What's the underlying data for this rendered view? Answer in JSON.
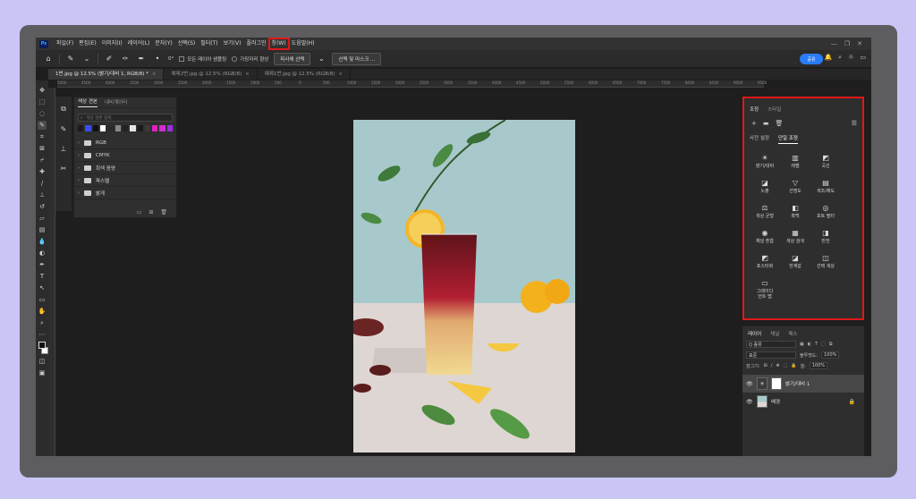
{
  "app": {
    "logo": "Ps"
  },
  "menu": [
    {
      "label": "파일(F)"
    },
    {
      "label": "편집(E)"
    },
    {
      "label": "이미지(I)"
    },
    {
      "label": "레이어(L)"
    },
    {
      "label": "문자(Y)"
    },
    {
      "label": "선택(S)"
    },
    {
      "label": "필터(T)"
    },
    {
      "label": "보기(V)"
    },
    {
      "label": "플러그인"
    },
    {
      "label": "창(W)"
    },
    {
      "label": "도움말(H)"
    }
  ],
  "window_controls": [
    "—",
    "❐",
    "✕"
  ],
  "options": {
    "angle": "0°",
    "sample_all_layers": "모든 레이어 샘플링",
    "enhance_edge": "가장자리 향상",
    "subject_button": "피사체 선택",
    "mask_button": "선택 및 마스크 ...",
    "share_label": "공유"
  },
  "tabs": [
    {
      "label": "1번.jpg @ 12.5% (밝기/대비 1, RGB/8) *",
      "active": true
    },
    {
      "label": "예제2번.jpg @ 12.5% (RGB/8)",
      "active": false
    },
    {
      "label": "예제1번.jpg @ 12.5% (RGB/8)",
      "active": false
    }
  ],
  "ruler_ticks": [
    "5000",
    "4500",
    "4000",
    "3500",
    "3000",
    "2500",
    "2000",
    "1500",
    "1000",
    "500",
    "0",
    "500",
    "1000",
    "1500",
    "2000",
    "2500",
    "3000",
    "3500",
    "4000",
    "4500",
    "5000",
    "5500",
    "6000",
    "6500",
    "7000",
    "7500",
    "8000",
    "8500",
    "9000",
    "9500"
  ],
  "swatches": {
    "tabs": [
      "색상 견본",
      "내비게이터"
    ],
    "search_placeholder": "색상 견본 검색",
    "colors": [
      "#1a1a1a",
      "#3b4cf0",
      "#111111",
      "#ffffff",
      "#2a2a2a",
      "#888888",
      "#222222",
      "#e6e6e6",
      "#1a1a1a",
      "#3a3a3a",
      "#e020c0",
      "#d02fd0",
      "#9b30e0"
    ],
    "folders": [
      "RGB",
      "CMYK",
      "회색 음영",
      "파스텔",
      "밝게"
    ]
  },
  "adjustments": {
    "tabs": [
      "조정",
      "스타일"
    ],
    "subtabs": [
      "사전 설정",
      "단일 조정"
    ],
    "items": [
      {
        "label": "밝기/대비",
        "icon": "☀"
      },
      {
        "label": "레벨",
        "icon": "▥"
      },
      {
        "label": "곡선",
        "icon": "◩"
      },
      {
        "label": "노출",
        "icon": "◪"
      },
      {
        "label": "선명도",
        "icon": "▽"
      },
      {
        "label": "색조/채도",
        "icon": "▤"
      },
      {
        "label": "색상 균형",
        "icon": "⚖"
      },
      {
        "label": "흑백",
        "icon": "◧"
      },
      {
        "label": "포토 필터",
        "icon": "◎"
      },
      {
        "label": "채널 혼합",
        "icon": "◉"
      },
      {
        "label": "색상 검색",
        "icon": "▦"
      },
      {
        "label": "반전",
        "icon": "◨"
      },
      {
        "label": "포스터화",
        "icon": "◩"
      },
      {
        "label": "한계값",
        "icon": "◪"
      },
      {
        "label": "선택 색상",
        "icon": "◫"
      },
      {
        "label": "그레이디\n언트 맵",
        "icon": "▭"
      }
    ]
  },
  "layers": {
    "tabs": [
      "레이어",
      "채널",
      "패스"
    ],
    "filter_label": "Q 종류",
    "blend_mode": "표준",
    "opacity_label": "불투명도:",
    "opacity_value": "100%",
    "lock_label": "잠그기:",
    "fill_label": "칠:",
    "fill_value": "100%",
    "rows": [
      {
        "name": "밝기/대비 1",
        "selected": true
      },
      {
        "name": "배경",
        "selected": false
      }
    ]
  },
  "colors": {
    "highlight": "#e01818",
    "accent": "#2a7cf6"
  }
}
